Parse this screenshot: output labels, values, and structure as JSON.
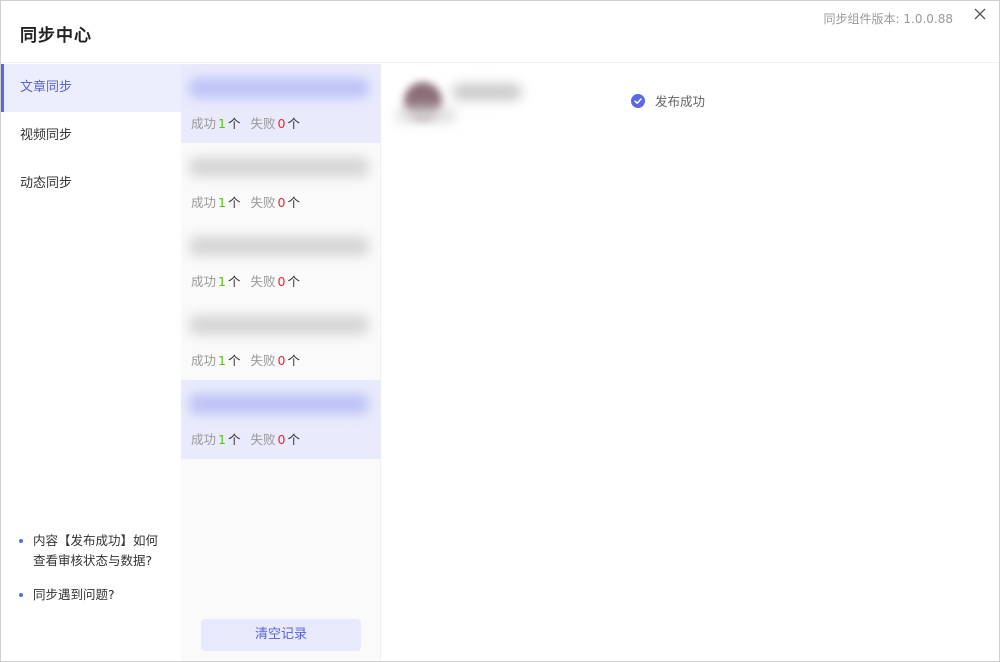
{
  "header": {
    "title": "同步中心",
    "version": "同步组件版本: 1.0.0.88"
  },
  "sidebar": {
    "items": [
      {
        "label": "文章同步",
        "active": true
      },
      {
        "label": "视频同步",
        "active": false
      },
      {
        "label": "动态同步",
        "active": false
      }
    ],
    "help": [
      "内容【发布成功】如何查看审核状态与数据?",
      "同步遇到问题?"
    ]
  },
  "records": [
    {
      "success_label": "成功",
      "success_count": "1",
      "fail_label": "失败",
      "fail_count": "0",
      "unit": "个",
      "selected": true
    },
    {
      "success_label": "成功",
      "success_count": "1",
      "fail_label": "失败",
      "fail_count": "0",
      "unit": "个",
      "selected": false
    },
    {
      "success_label": "成功",
      "success_count": "1",
      "fail_label": "失败",
      "fail_count": "0",
      "unit": "个",
      "selected": false
    },
    {
      "success_label": "成功",
      "success_count": "1",
      "fail_label": "失败",
      "fail_count": "0",
      "unit": "个",
      "selected": false
    },
    {
      "success_label": "成功",
      "success_count": "1",
      "fail_label": "失败",
      "fail_count": "0",
      "unit": "个",
      "selected": true
    }
  ],
  "clear_button": "清空记录",
  "detail": {
    "status": "发布成功"
  },
  "colors": {
    "accent": "#5b6ae3",
    "success": "#52c41a",
    "fail": "#f5222d"
  }
}
